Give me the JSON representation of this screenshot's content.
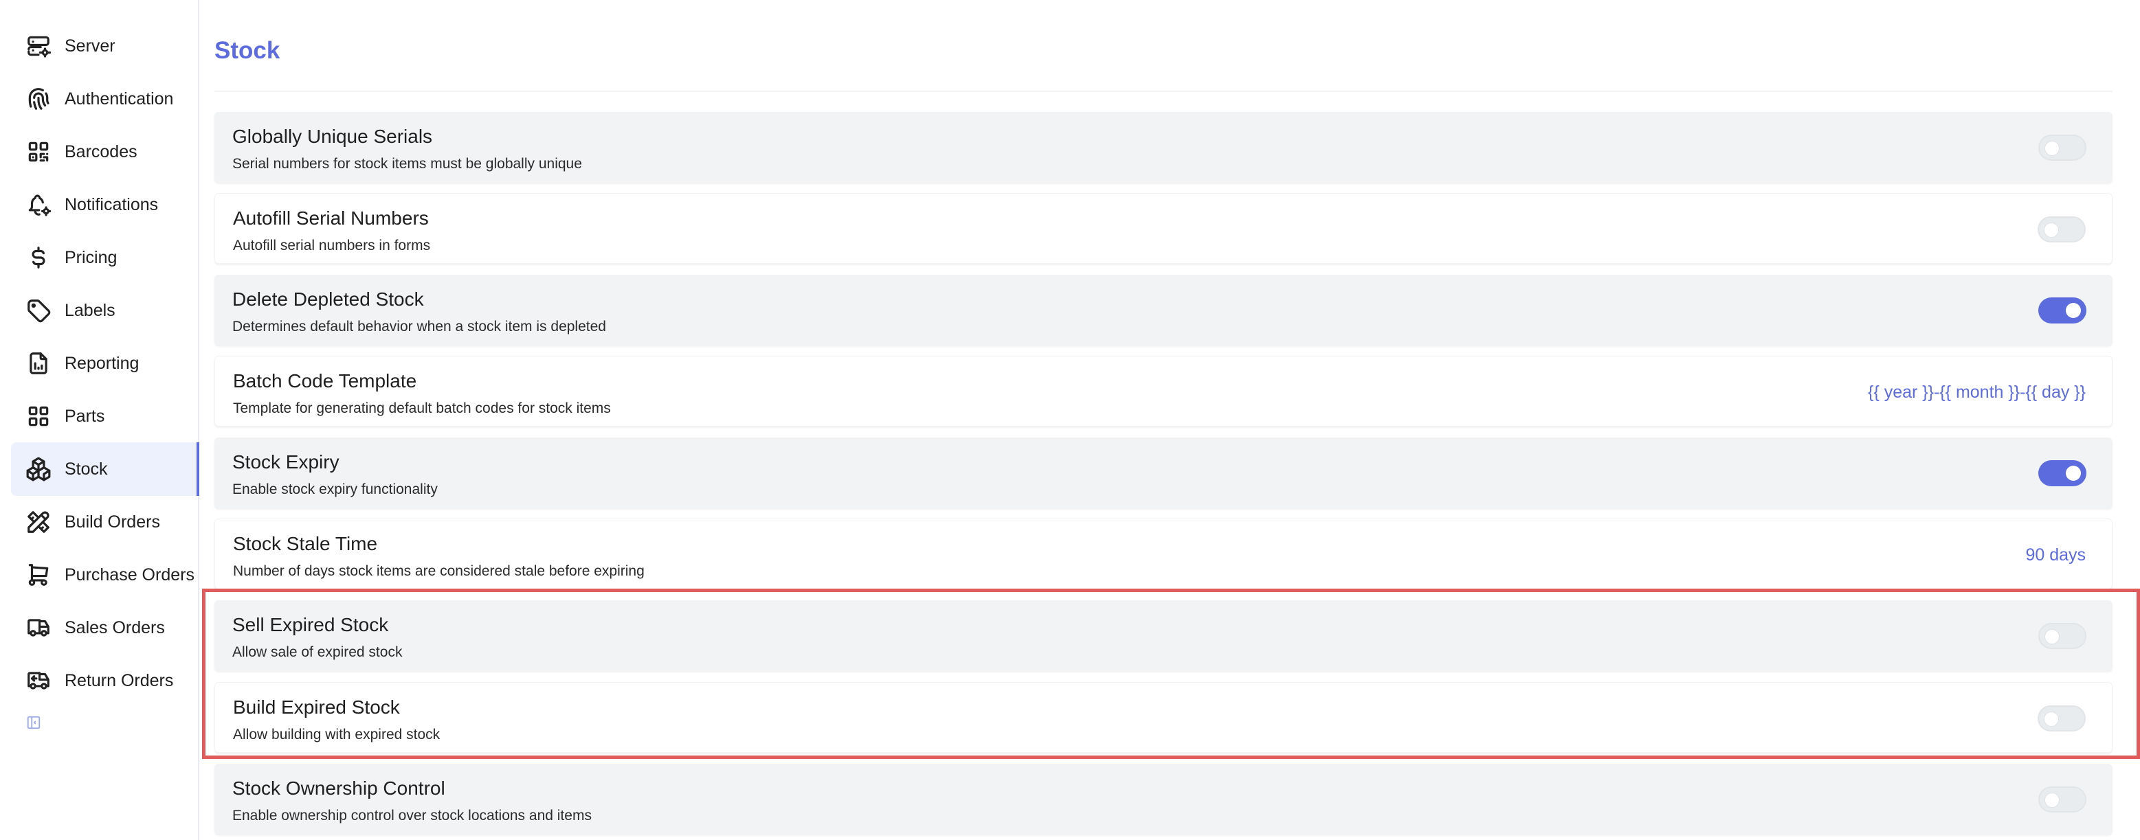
{
  "sidebar": {
    "items": [
      {
        "label": "Server",
        "icon": "server-icon"
      },
      {
        "label": "Authentication",
        "icon": "fingerprint-icon"
      },
      {
        "label": "Barcodes",
        "icon": "qrcode-icon"
      },
      {
        "label": "Notifications",
        "icon": "bell-cog-icon"
      },
      {
        "label": "Pricing",
        "icon": "dollar-icon"
      },
      {
        "label": "Labels",
        "icon": "tag-icon"
      },
      {
        "label": "Reporting",
        "icon": "report-icon"
      },
      {
        "label": "Parts",
        "icon": "grid-icon"
      },
      {
        "label": "Stock",
        "icon": "packages-icon",
        "active": true
      },
      {
        "label": "Build Orders",
        "icon": "tools-icon"
      },
      {
        "label": "Purchase Orders",
        "icon": "cart-icon"
      },
      {
        "label": "Sales Orders",
        "icon": "truck-icon"
      },
      {
        "label": "Return Orders",
        "icon": "truck-return-icon"
      }
    ],
    "collapse_icon": "sidebar-collapse-icon"
  },
  "main": {
    "title": "Stock",
    "accent_color": "#5c6bdd",
    "highlight_color": "#e05c5c",
    "settings": [
      {
        "title": "Globally Unique Serials",
        "description": "Serial numbers for stock items must be globally unique",
        "type": "toggle",
        "enabled": false
      },
      {
        "title": "Autofill Serial Numbers",
        "description": "Autofill serial numbers in forms",
        "type": "toggle",
        "enabled": false
      },
      {
        "title": "Delete Depleted Stock",
        "description": "Determines default behavior when a stock item is depleted",
        "type": "toggle",
        "enabled": true
      },
      {
        "title": "Batch Code Template",
        "description": "Template for generating default batch codes for stock items",
        "type": "value",
        "value": "{{ year }}-{{ month }}-{{ day }}"
      },
      {
        "title": "Stock Expiry",
        "description": "Enable stock expiry functionality",
        "type": "toggle",
        "enabled": true
      },
      {
        "title": "Stock Stale Time",
        "description": "Number of days stock items are considered stale before expiring",
        "type": "value",
        "value": "90 days"
      },
      {
        "title": "Sell Expired Stock",
        "description": "Allow sale of expired stock",
        "type": "toggle",
        "enabled": false
      },
      {
        "title": "Build Expired Stock",
        "description": "Allow building with expired stock",
        "type": "toggle",
        "enabled": false
      },
      {
        "title": "Stock Ownership Control",
        "description": "Enable ownership control over stock locations and items",
        "type": "toggle",
        "enabled": false
      }
    ]
  }
}
